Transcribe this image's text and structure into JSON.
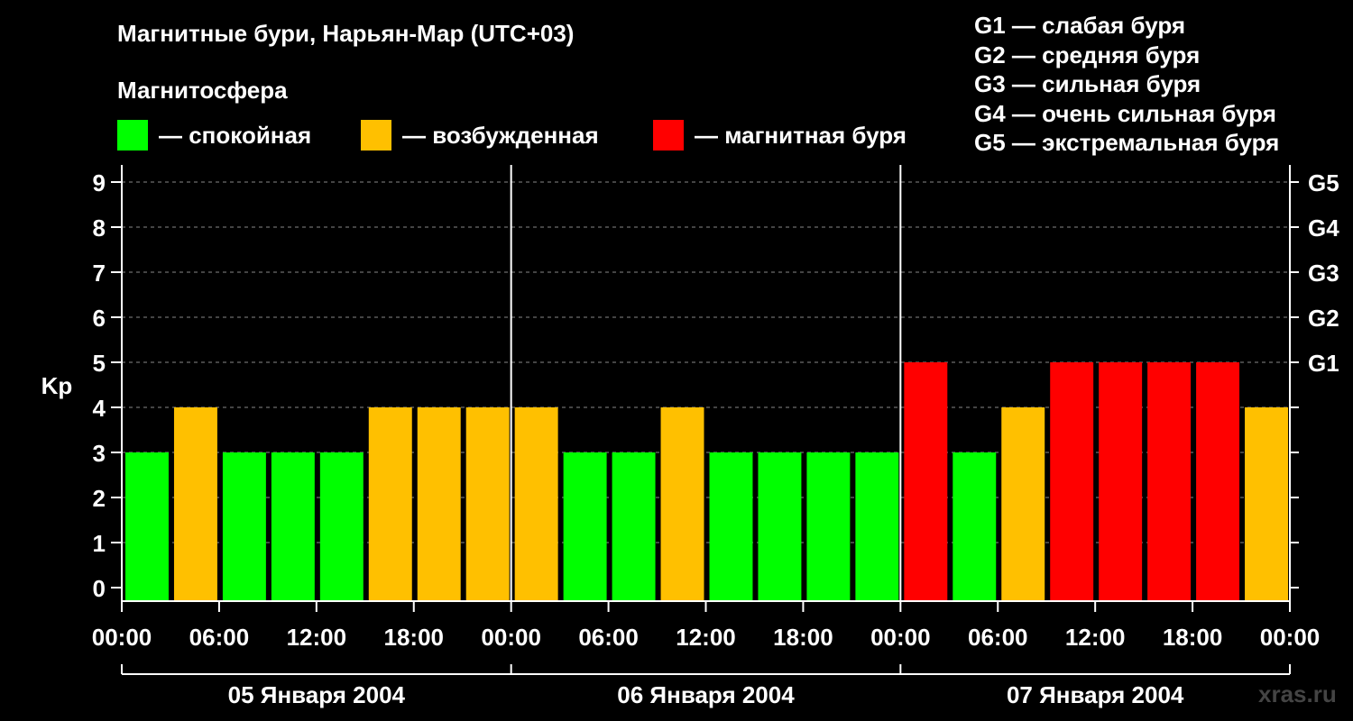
{
  "title": "Магнитные бури, Нарьян-Мар (UTC+03)",
  "magnetosphere_title": "Магнитосфера",
  "legend": [
    {
      "label": "— спокойная",
      "color": "#00ff00"
    },
    {
      "label": "— возбужденная",
      "color": "#ffc000"
    },
    {
      "label": "— магнитная буря",
      "color": "#ff0000"
    }
  ],
  "g_legend": [
    "G1 — слабая буря",
    "G2 — средняя буря",
    "G3 — сильная буря",
    "G4 — очень сильная буря",
    "G5 — экстремальная буря"
  ],
  "watermark": "xras.ru",
  "colors": {
    "quiet": "#00ff00",
    "active": "#ffc000",
    "storm": "#ff0000",
    "background": "#000000",
    "axis": "#ffffff",
    "grid": "#888888"
  },
  "chart_data": {
    "type": "bar",
    "ylabel": "Kp",
    "ylim": [
      0,
      9
    ],
    "yticks": [
      0,
      1,
      2,
      3,
      4,
      5,
      6,
      7,
      8,
      9
    ],
    "right_ticks": [
      {
        "value": 5,
        "label": "G1"
      },
      {
        "value": 6,
        "label": "G2"
      },
      {
        "value": 7,
        "label": "G3"
      },
      {
        "value": 8,
        "label": "G4"
      },
      {
        "value": 9,
        "label": "G5"
      }
    ],
    "grid": "dashed horizontal",
    "xticks": [
      "00:00",
      "06:00",
      "12:00",
      "18:00",
      "00:00",
      "06:00",
      "12:00",
      "18:00",
      "00:00",
      "06:00",
      "12:00",
      "18:00",
      "00:00"
    ],
    "days": [
      "05 Января 2004",
      "06 Января 2004",
      "07 Января 2004"
    ],
    "interval_hours": 3,
    "values": [
      3,
      4,
      3,
      3,
      3,
      4,
      4,
      4,
      4,
      3,
      3,
      4,
      3,
      3,
      3,
      3,
      5,
      3,
      4,
      5,
      5,
      5,
      5,
      4
    ],
    "levels": [
      "quiet",
      "active",
      "quiet",
      "quiet",
      "quiet",
      "active",
      "active",
      "active",
      "active",
      "quiet",
      "quiet",
      "active",
      "quiet",
      "quiet",
      "quiet",
      "quiet",
      "storm",
      "quiet",
      "active",
      "storm",
      "storm",
      "storm",
      "storm",
      "active"
    ]
  }
}
